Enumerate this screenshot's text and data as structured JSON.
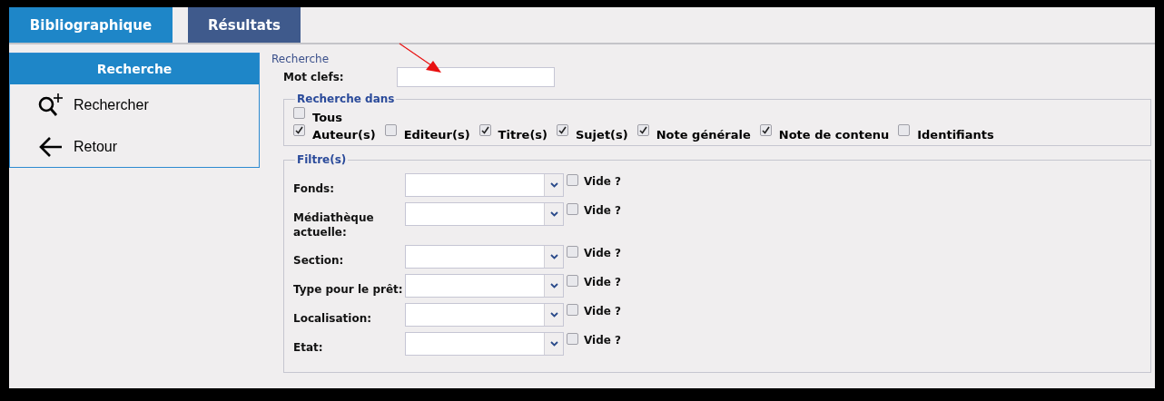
{
  "tabs": [
    {
      "label": "Bibliographique",
      "selected": true
    },
    {
      "label": "Résultats",
      "selected": false
    }
  ],
  "sidebar": {
    "title": "Recherche",
    "items": [
      {
        "label": "Rechercher",
        "kind": "search"
      },
      {
        "label": "Retour",
        "kind": "back"
      }
    ]
  },
  "search": {
    "legend": "Recherche",
    "keyword_label": "Mot clefs:"
  },
  "search_in": {
    "legend": "Recherche dans",
    "all": {
      "label": "Tous",
      "checked": false
    },
    "options": [
      {
        "label": "Auteur(s)",
        "checked": true
      },
      {
        "label": "Editeur(s)",
        "checked": false
      },
      {
        "label": "Titre(s)",
        "checked": true
      },
      {
        "label": "Sujet(s)",
        "checked": true
      },
      {
        "label": "Note générale",
        "checked": true
      },
      {
        "label": "Note de contenu",
        "checked": true
      },
      {
        "label": "Identifiants",
        "checked": false
      }
    ]
  },
  "filters": {
    "legend": "Filtre(s)",
    "rows": [
      {
        "label": "Fonds:",
        "empty_label": "Vide ?",
        "empty": false
      },
      {
        "label": "Médiathèque actuelle:",
        "empty_label": "Vide ?",
        "empty": false
      },
      {
        "label": "Section:",
        "empty_label": "Vide ?",
        "empty": false
      },
      {
        "label": "Type pour le prêt:",
        "empty_label": "Vide ?",
        "empty": false
      },
      {
        "label": "Localisation:",
        "empty_label": "Vide ?",
        "empty": false
      },
      {
        "label": "Etat:",
        "empty_label": "Vide ?",
        "empty": false
      }
    ]
  }
}
